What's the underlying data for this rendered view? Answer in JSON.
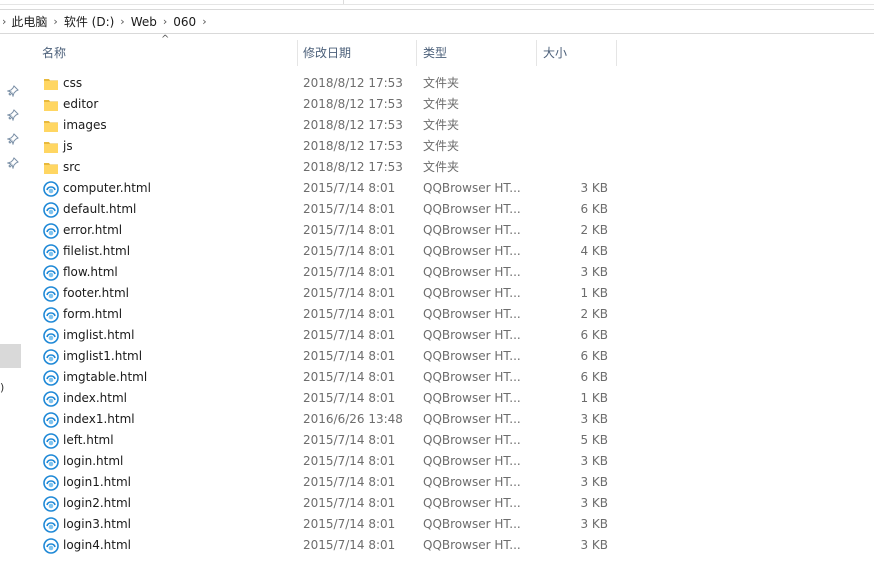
{
  "breadcrumb": {
    "items": [
      "此电脑",
      "软件 (D:)",
      "Web",
      "060"
    ]
  },
  "columns": {
    "name": "名称",
    "modified": "修改日期",
    "type": "类型",
    "size": "大小"
  },
  "colors": {
    "folder": "#ffd662",
    "html_icon": "#1e88d6",
    "header_text": "#4c607a",
    "muted_text": "#6d6d6d"
  },
  "files": [
    {
      "name": "css",
      "date": "2018/8/12 17:53",
      "type": "文件夹",
      "size": "",
      "icon": "folder-icon"
    },
    {
      "name": "editor",
      "date": "2018/8/12 17:53",
      "type": "文件夹",
      "size": "",
      "icon": "folder-icon"
    },
    {
      "name": "images",
      "date": "2018/8/12 17:53",
      "type": "文件夹",
      "size": "",
      "icon": "folder-icon"
    },
    {
      "name": "js",
      "date": "2018/8/12 17:53",
      "type": "文件夹",
      "size": "",
      "icon": "folder-icon"
    },
    {
      "name": "src",
      "date": "2018/8/12 17:53",
      "type": "文件夹",
      "size": "",
      "icon": "folder-icon"
    },
    {
      "name": "computer.html",
      "date": "2015/7/14 8:01",
      "type": "QQBrowser HT...",
      "size": "3 KB",
      "icon": "qqbrowser-html-icon"
    },
    {
      "name": "default.html",
      "date": "2015/7/14 8:01",
      "type": "QQBrowser HT...",
      "size": "6 KB",
      "icon": "qqbrowser-html-icon"
    },
    {
      "name": "error.html",
      "date": "2015/7/14 8:01",
      "type": "QQBrowser HT...",
      "size": "2 KB",
      "icon": "qqbrowser-html-icon"
    },
    {
      "name": "filelist.html",
      "date": "2015/7/14 8:01",
      "type": "QQBrowser HT...",
      "size": "4 KB",
      "icon": "qqbrowser-html-icon"
    },
    {
      "name": "flow.html",
      "date": "2015/7/14 8:01",
      "type": "QQBrowser HT...",
      "size": "3 KB",
      "icon": "qqbrowser-html-icon"
    },
    {
      "name": "footer.html",
      "date": "2015/7/14 8:01",
      "type": "QQBrowser HT...",
      "size": "1 KB",
      "icon": "qqbrowser-html-icon"
    },
    {
      "name": "form.html",
      "date": "2015/7/14 8:01",
      "type": "QQBrowser HT...",
      "size": "2 KB",
      "icon": "qqbrowser-html-icon"
    },
    {
      "name": "imglist.html",
      "date": "2015/7/14 8:01",
      "type": "QQBrowser HT...",
      "size": "6 KB",
      "icon": "qqbrowser-html-icon"
    },
    {
      "name": "imglist1.html",
      "date": "2015/7/14 8:01",
      "type": "QQBrowser HT...",
      "size": "6 KB",
      "icon": "qqbrowser-html-icon"
    },
    {
      "name": "imgtable.html",
      "date": "2015/7/14 8:01",
      "type": "QQBrowser HT...",
      "size": "6 KB",
      "icon": "qqbrowser-html-icon"
    },
    {
      "name": "index.html",
      "date": "2015/7/14 8:01",
      "type": "QQBrowser HT...",
      "size": "1 KB",
      "icon": "qqbrowser-html-icon"
    },
    {
      "name": "index1.html",
      "date": "2016/6/26 13:48",
      "type": "QQBrowser HT...",
      "size": "3 KB",
      "icon": "qqbrowser-html-icon"
    },
    {
      "name": "left.html",
      "date": "2015/7/14 8:01",
      "type": "QQBrowser HT...",
      "size": "5 KB",
      "icon": "qqbrowser-html-icon"
    },
    {
      "name": "login.html",
      "date": "2015/7/14 8:01",
      "type": "QQBrowser HT...",
      "size": "3 KB",
      "icon": "qqbrowser-html-icon"
    },
    {
      "name": "login1.html",
      "date": "2015/7/14 8:01",
      "type": "QQBrowser HT...",
      "size": "3 KB",
      "icon": "qqbrowser-html-icon"
    },
    {
      "name": "login2.html",
      "date": "2015/7/14 8:01",
      "type": "QQBrowser HT...",
      "size": "3 KB",
      "icon": "qqbrowser-html-icon"
    },
    {
      "name": "login3.html",
      "date": "2015/7/14 8:01",
      "type": "QQBrowser HT...",
      "size": "3 KB",
      "icon": "qqbrowser-html-icon"
    },
    {
      "name": "login4.html",
      "date": "2015/7/14 8:01",
      "type": "QQBrowser HT...",
      "size": "3 KB",
      "icon": "qqbrowser-html-icon"
    }
  ],
  "left_pane": {
    "pins": [
      "pin-icon",
      "pin-icon",
      "pin-icon",
      "pin-icon"
    ],
    "glyph": ")"
  }
}
